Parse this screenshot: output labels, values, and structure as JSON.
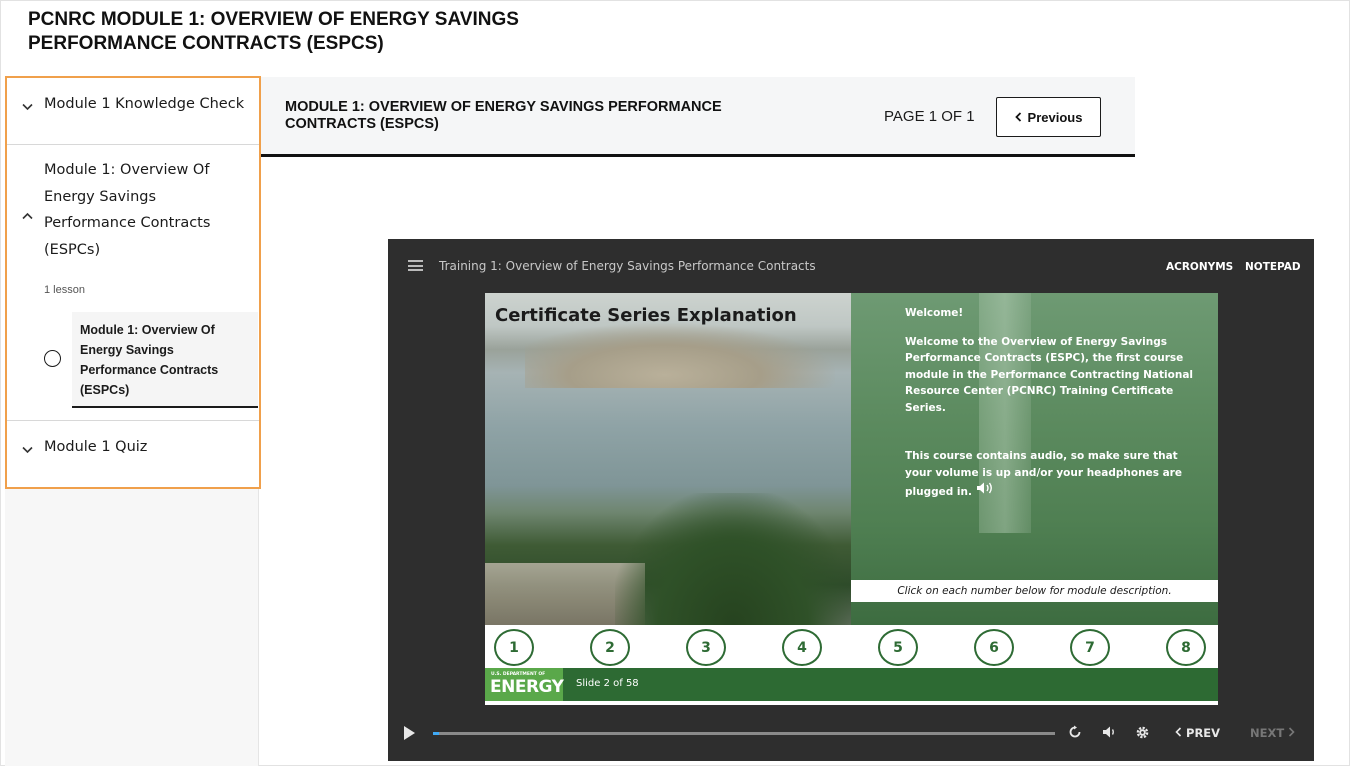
{
  "page": {
    "title_line1": "PCNRC MODULE 1: OVERVIEW OF ENERGY SAVINGS",
    "title_line2": "PERFORMANCE CONTRACTS (ESPCS)"
  },
  "sidebar": {
    "items": [
      {
        "label": "Module 1 Knowledge Check",
        "expanded": false
      },
      {
        "label": "Module 1: Overview Of Energy Savings Performance Contracts (ESPCs)",
        "expanded": true,
        "lesson_count": "1 lesson",
        "lessons": [
          {
            "label": "Module 1: Overview Of Energy Savings Performance Contracts (ESPCs)",
            "completed": false
          }
        ]
      },
      {
        "label": "Module 1 Quiz",
        "expanded": false
      }
    ],
    "highlight_color": "#f0a04b"
  },
  "lesson_header": {
    "title": "MODULE 1: OVERVIEW OF ENERGY SAVINGS PERFORMANCE CONTRACTS (ESPCS)",
    "page_indicator": "PAGE 1 OF 1",
    "previous_label": "Previous"
  },
  "player": {
    "title": "Training 1: Overview of Energy Savings Performance Contracts",
    "acronyms_label": "ACRONYMS",
    "notepad_label": "NOTEPAD",
    "slide": {
      "heading": "Certificate Series Explanation",
      "welcome": "Welcome!",
      "paragraph1": "Welcome to the Overview of Energy Savings Performance Contracts (ESPC), the first course module in the Performance Contracting National Resource Center (PCNRC) Training Certificate Series.",
      "paragraph2": "This course contains audio, so make sure that your volume is up and/or your headphones are plugged in.",
      "caption": "Click on each number below for module description.",
      "numbers": [
        "1",
        "2",
        "3",
        "4",
        "5",
        "6",
        "7",
        "8"
      ],
      "logo_small": "U.S. DEPARTMENT OF",
      "logo_large": "ENERGY",
      "slide_counter": "Slide 2 of 58",
      "accent_color": "#2e6b34"
    },
    "controls": {
      "prev_label": "PREV",
      "next_label": "NEXT",
      "progress": 0.01
    }
  }
}
